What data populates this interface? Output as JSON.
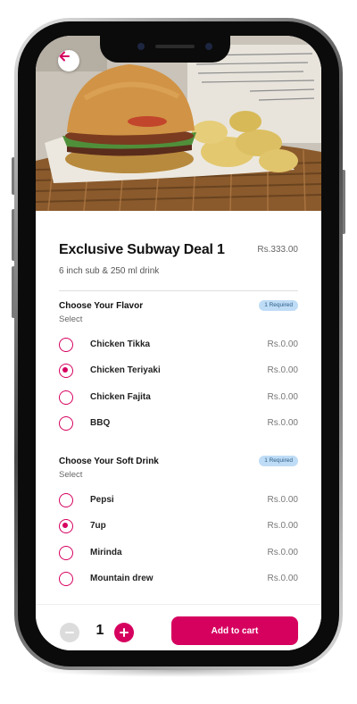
{
  "product": {
    "name": "Exclusive Subway Deal 1",
    "price": "Rs.333.00",
    "description": "6 inch sub & 250 ml drink"
  },
  "flavor_section": {
    "title": "Choose Your Flavor",
    "subtitle": "Select",
    "badge": "1 Required",
    "options": [
      {
        "label": "Chicken Tikka",
        "price": "Rs.0.00",
        "selected": false
      },
      {
        "label": "Chicken Teriyaki",
        "price": "Rs.0.00",
        "selected": true
      },
      {
        "label": "Chicken Fajita",
        "price": "Rs.0.00",
        "selected": false
      },
      {
        "label": "BBQ",
        "price": "Rs.0.00",
        "selected": false
      }
    ]
  },
  "drink_section": {
    "title": "Choose Your Soft Drink",
    "subtitle": "Select",
    "badge": "1 Required",
    "options": [
      {
        "label": "Pepsi",
        "price": "Rs.0.00",
        "selected": false
      },
      {
        "label": "7up",
        "price": "Rs.0.00",
        "selected": true
      },
      {
        "label": "Mirinda",
        "price": "Rs.0.00",
        "selected": false
      },
      {
        "label": "Mountain drew",
        "price": "Rs.0.00",
        "selected": false
      }
    ]
  },
  "footer": {
    "quantity": "1",
    "add_label": "Add to cart"
  },
  "colors": {
    "accent": "#d6005f",
    "badge_bg": "#bfdcf6",
    "disabled": "#dcdcdc"
  },
  "icons": {
    "back": "arrow-left-icon",
    "minus": "minus-circle-icon",
    "plus": "plus-circle-icon"
  }
}
